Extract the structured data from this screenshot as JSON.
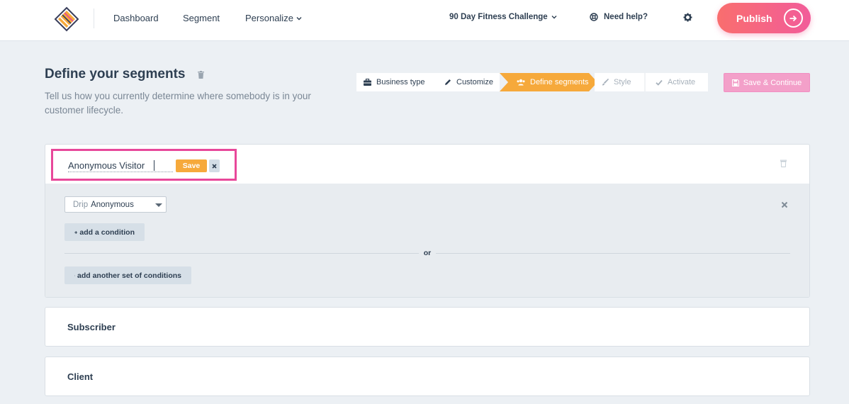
{
  "nav": {
    "items": [
      {
        "label": "Dashboard"
      },
      {
        "label": "Segment"
      },
      {
        "label": "Personalize"
      }
    ],
    "project": "90 Day Fitness Challenge",
    "help": "Need help?",
    "publish": "Publish"
  },
  "header": {
    "title": "Define your segments",
    "subtitle": "Tell us how you currently determine where somebody is in your customer lifecycle."
  },
  "stepper": {
    "steps": [
      {
        "label": "Business type",
        "icon": "briefcase-icon",
        "state": "done"
      },
      {
        "label": "Customize",
        "icon": "pencil-icon",
        "state": "done"
      },
      {
        "label": "Define segments",
        "icon": "users-icon",
        "state": "active"
      },
      {
        "label": "Style",
        "icon": "brush-icon",
        "state": "pending"
      },
      {
        "label": "Activate",
        "icon": "check-icon",
        "state": "pending"
      }
    ],
    "save_continue": "Save & Continue"
  },
  "segments": [
    {
      "name": "Anonymous Visitor",
      "editing": true,
      "save_label": "Save",
      "conditions": [
        {
          "prefix": "Drip",
          "value": "Anonymous"
        }
      ],
      "add_condition": "add a condition",
      "or_label": "or",
      "add_set": "add another set of conditions"
    },
    {
      "name": "Subscriber"
    },
    {
      "name": "Client"
    }
  ],
  "colors": {
    "accent_orange": "#f6a93b",
    "publish_pink": "#f25c9a",
    "highlight_border": "#e8489a",
    "text_dark": "#2e3f52"
  }
}
